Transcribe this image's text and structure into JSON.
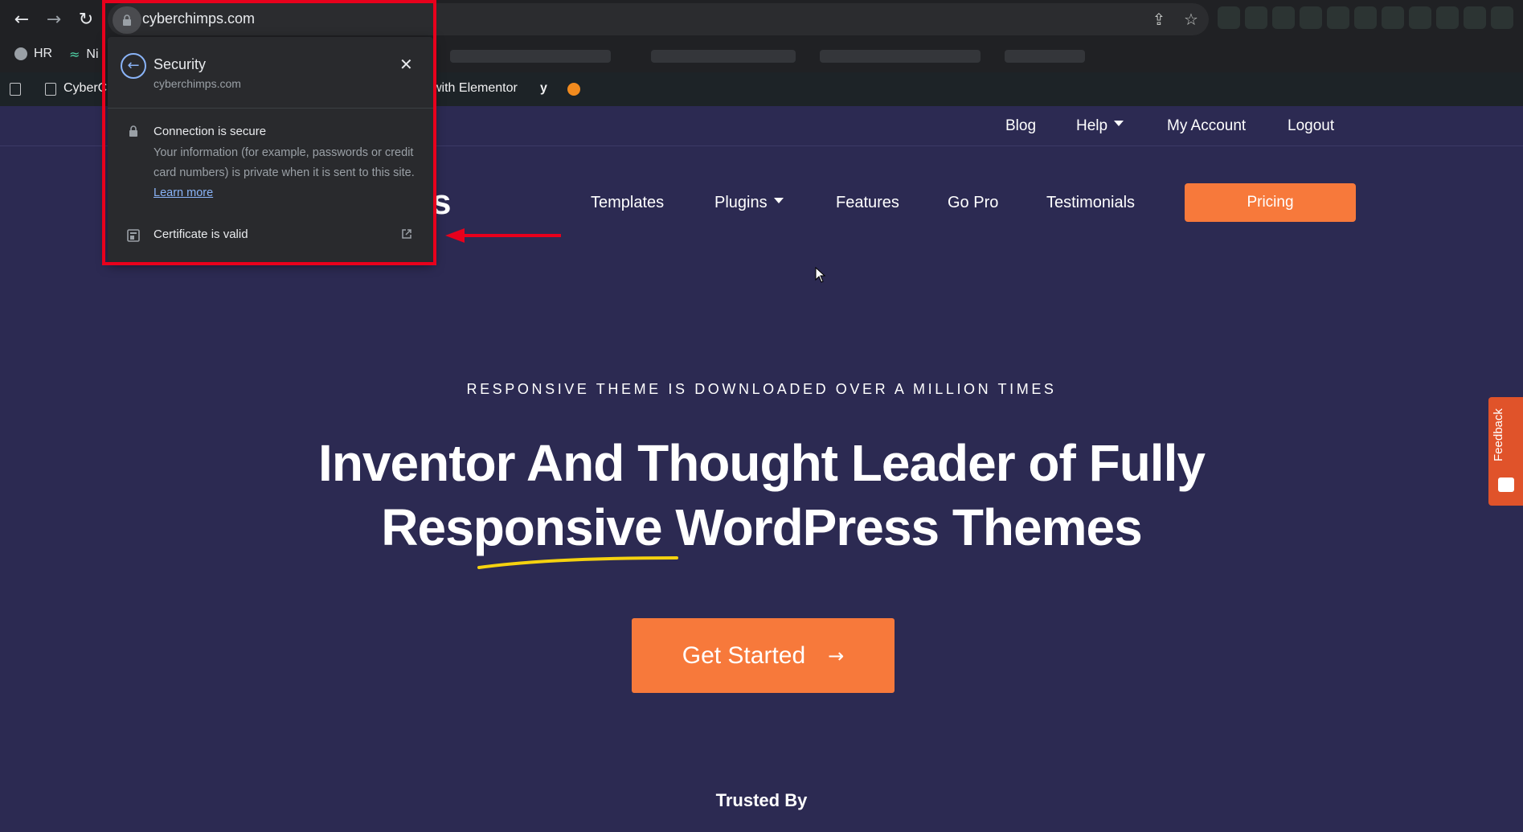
{
  "browser": {
    "url": "cyberchimps.com",
    "bookmarks": [
      {
        "label": "HR"
      },
      {
        "label": "Ni"
      }
    ],
    "icons": {
      "back": "arrow-left-icon",
      "forward": "arrow-right-icon",
      "reload": "reload-icon",
      "share": "share-icon",
      "star": "star-icon"
    }
  },
  "admin_bar": {
    "item_cyberchimps": "CyberCh",
    "item_elementor": "with Elementor"
  },
  "security_popup": {
    "title": "Security",
    "subtitle": "cyberchimps.com",
    "connection_title": "Connection is secure",
    "connection_desc": "Your information (for example, passwords or credit card numbers) is private when it is sent to this site.",
    "learn_more": "Learn more",
    "certificate": "Certificate is valid"
  },
  "site": {
    "logo_partial": "s",
    "top_nav": [
      "Blog",
      "Help",
      "My Account",
      "Logout"
    ],
    "main_nav": [
      "Templates",
      "Plugins",
      "Features",
      "Go Pro",
      "Testimonials"
    ],
    "pricing": "Pricing",
    "tagline": "RESPONSIVE THEME IS DOWNLOADED OVER A MILLION TIMES",
    "headline_line1": "Inventor And Thought Leader of Fully",
    "headline_line2": "Responsive WordPress Themes",
    "cta": "Get Started",
    "trusted_by": "Trusted By",
    "feedback": "Feedback"
  },
  "colors": {
    "page_bg": "#2c2a52",
    "accent": "#f7793b",
    "highlight_box": "#e8001c",
    "underline": "#f5d20f"
  }
}
